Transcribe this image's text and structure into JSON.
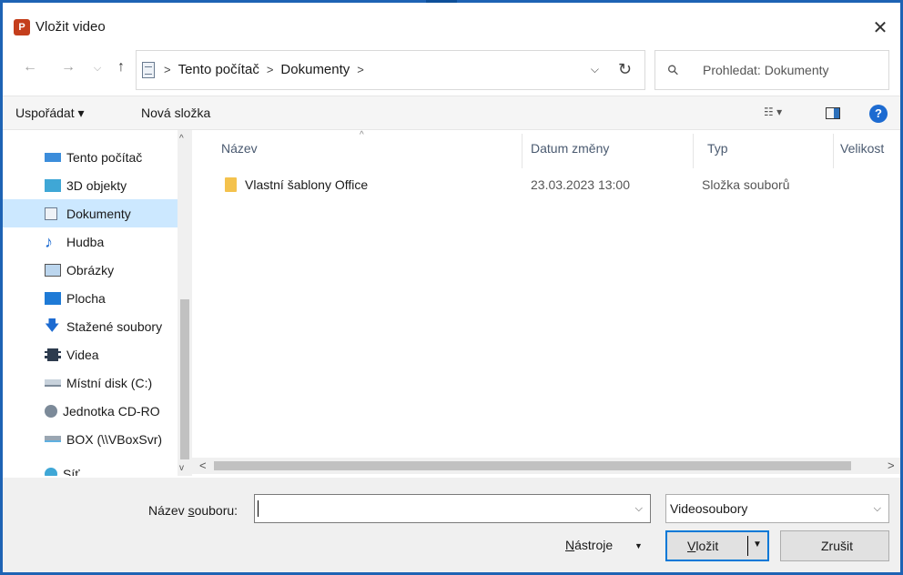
{
  "window": {
    "title": "Vložit video",
    "app_icon_letter": "P"
  },
  "address": {
    "crumbs": [
      "Tento počítač",
      "Dokumenty"
    ],
    "search_placeholder": "Prohledat: Dokumenty"
  },
  "toolbar": {
    "organize": "Uspořádat ▾",
    "new_folder": "Nová složka",
    "help": "?"
  },
  "nav": {
    "items": [
      {
        "label": "Tento počítač",
        "icon": "computer-icon"
      },
      {
        "label": "3D objekty",
        "icon": "cube-icon"
      },
      {
        "label": "Dokumenty",
        "icon": "document-icon",
        "selected": true
      },
      {
        "label": "Hudba",
        "icon": "music-note-icon"
      },
      {
        "label": "Obrázky",
        "icon": "picture-icon"
      },
      {
        "label": "Plocha",
        "icon": "desktop-icon"
      },
      {
        "label": "Stažené soubory",
        "icon": "download-arrow-icon"
      },
      {
        "label": "Videa",
        "icon": "film-icon"
      },
      {
        "label": "Místní disk (C:)",
        "icon": "drive-icon"
      },
      {
        "label": "Jednotka CD-RO",
        "icon": "cd-drive-icon"
      },
      {
        "label": "BOX (\\\\VBoxSvr)",
        "icon": "network-drive-icon"
      },
      {
        "label": "Síť",
        "icon": "network-icon"
      }
    ]
  },
  "columns": {
    "name": "Název",
    "date": "Datum změny",
    "type": "Typ",
    "size": "Velikost"
  },
  "files": [
    {
      "name": "Vlastní šablony Office",
      "date": "23.03.2023 13:00",
      "type": "Složka souborů",
      "size": ""
    }
  ],
  "bottom": {
    "filename_label_pre": "Název ",
    "filename_label_accel": "s",
    "filename_label_post": "ouboru:",
    "filename_value": "",
    "filter": "Videosoubory",
    "tools_accel": "N",
    "tools_rest": "ástroje",
    "insert_accel": "V",
    "insert_rest": "ložit",
    "cancel": "Zrušit"
  },
  "colors": {
    "accent": "#0078d7",
    "selection": "#cce8ff",
    "frame": "#1e63b4",
    "folder": "#f4c24d"
  }
}
